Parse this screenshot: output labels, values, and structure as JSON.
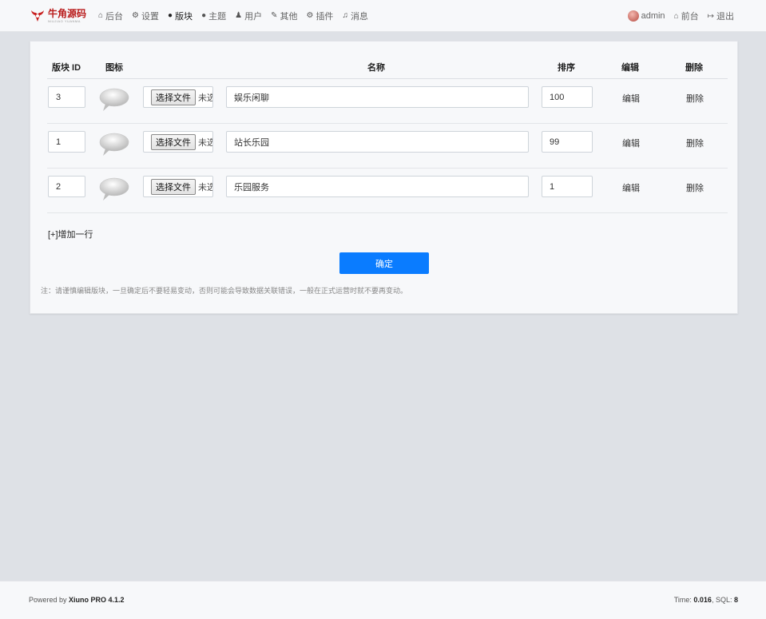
{
  "brand": {
    "name": "牛角源码",
    "tagline": "NIUJIAO YUANMA"
  },
  "nav": {
    "items": [
      {
        "icon": "home-icon",
        "glyph": "⌂",
        "label": "后台"
      },
      {
        "icon": "gear-icon",
        "glyph": "⚙",
        "label": "设置"
      },
      {
        "icon": "comment-icon",
        "glyph": "●",
        "label": "版块"
      },
      {
        "icon": "comment-icon",
        "glyph": "●",
        "label": "主题"
      },
      {
        "icon": "user-icon",
        "glyph": "♟",
        "label": "用户"
      },
      {
        "icon": "wrench-icon",
        "glyph": "✎",
        "label": "其他"
      },
      {
        "icon": "cogs-icon",
        "glyph": "⚙",
        "label": "插件"
      },
      {
        "icon": "bell-icon",
        "glyph": "♫",
        "label": "消息"
      }
    ],
    "active_index": 2
  },
  "user_nav": {
    "username": "admin",
    "front_label": "前台",
    "logout_label": "退出"
  },
  "table": {
    "headers": {
      "id": "版块 ID",
      "icon": "图标",
      "name": "名称",
      "order": "排序",
      "edit": "编辑",
      "delete": "删除"
    },
    "file_button_label": "选择文件",
    "file_status": "未选择任何文件",
    "rows": [
      {
        "id": "3",
        "name": "娱乐闲聊",
        "order": "100",
        "edit": "编辑",
        "delete": "删除"
      },
      {
        "id": "1",
        "name": "站长乐园",
        "order": "99",
        "edit": "编辑",
        "delete": "删除"
      },
      {
        "id": "2",
        "name": "乐园服务",
        "order": "1",
        "edit": "编辑",
        "delete": "删除"
      }
    ]
  },
  "add_row_label": "[+]增加一行",
  "submit_label": "确定",
  "note": "注：请谨慎编辑版块，一旦确定后不要轻易变动，否则可能会导致数据关联错误，一般在正式运营时就不要再变动。",
  "footer": {
    "powered_prefix": "Powered by",
    "product": "Xiuno PRO 4.1.2",
    "time_label": "Time:",
    "time_value": "0.016",
    "sql_label": "SQL:",
    "sql_value": "8"
  },
  "colors": {
    "primary": "#0a7cff",
    "page_bg": "#dee1e6",
    "card_bg": "#f7f8fa",
    "brand_red": "#b91c1c"
  }
}
